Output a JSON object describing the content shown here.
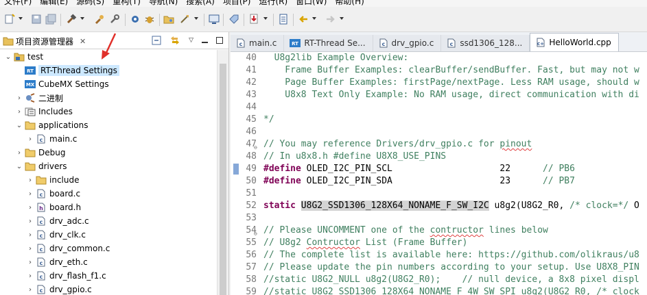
{
  "menu": [
    "文件(F)",
    "编辑(E)",
    "源码(S)",
    "重构(T)",
    "导航(N)",
    "搜索(A)",
    "项目(P)",
    "运行(R)",
    "窗口(W)",
    "帮助(H)"
  ],
  "explorer": {
    "tab_title": "项目资源管理器",
    "close_glyph": "✕",
    "tree": [
      {
        "label": "test",
        "depth": 0,
        "twisty": "⌄",
        "icon": "project-folder-icon"
      },
      {
        "label": "RT-Thread Settings",
        "depth": 1,
        "twisty": "",
        "icon": "rt-thread-icon",
        "selected": true
      },
      {
        "label": "CubeMX Settings",
        "depth": 1,
        "twisty": "",
        "icon": "cubemx-icon"
      },
      {
        "label": "二进制",
        "depth": 1,
        "twisty": "›",
        "icon": "binary-icon"
      },
      {
        "label": "Includes",
        "depth": 1,
        "twisty": "›",
        "icon": "includes-icon"
      },
      {
        "label": "applications",
        "depth": 1,
        "twisty": "⌄",
        "icon": "folder-icon"
      },
      {
        "label": "main.c",
        "depth": 2,
        "twisty": "›",
        "icon": "c-file-icon"
      },
      {
        "label": "Debug",
        "depth": 1,
        "twisty": "›",
        "icon": "folder-icon"
      },
      {
        "label": "drivers",
        "depth": 1,
        "twisty": "⌄",
        "icon": "folder-icon"
      },
      {
        "label": "include",
        "depth": 2,
        "twisty": "›",
        "icon": "folder-icon"
      },
      {
        "label": "board.c",
        "depth": 2,
        "twisty": "›",
        "icon": "c-file-icon"
      },
      {
        "label": "board.h",
        "depth": 2,
        "twisty": "›",
        "icon": "h-file-icon"
      },
      {
        "label": "drv_adc.c",
        "depth": 2,
        "twisty": "›",
        "icon": "c-file-icon"
      },
      {
        "label": "drv_clk.c",
        "depth": 2,
        "twisty": "›",
        "icon": "c-file-icon"
      },
      {
        "label": "drv_common.c",
        "depth": 2,
        "twisty": "›",
        "icon": "c-file-icon"
      },
      {
        "label": "drv_eth.c",
        "depth": 2,
        "twisty": "›",
        "icon": "c-file-icon"
      },
      {
        "label": "drv_flash_f1.c",
        "depth": 2,
        "twisty": "›",
        "icon": "c-file-icon"
      },
      {
        "label": "drv_gpio.c",
        "depth": 2,
        "twisty": "›",
        "icon": "c-file-icon"
      }
    ]
  },
  "editor": {
    "tabs": [
      {
        "label": "main.c",
        "icon": "c-file-icon"
      },
      {
        "label": "RT-Thread Se...",
        "icon": "rt-thread-icon"
      },
      {
        "label": "drv_gpio.c",
        "icon": "c-file-icon"
      },
      {
        "label": "ssd1306_128...",
        "icon": "c-file-icon"
      },
      {
        "label": "HelloWorld.cpp",
        "icon": "cpp-file-icon",
        "active": true
      }
    ],
    "lines": [
      {
        "n": "40",
        "segs": [
          {
            "t": "  U8g2lib Example Overview:",
            "c": "cm"
          }
        ]
      },
      {
        "n": "41",
        "segs": [
          {
            "t": "    Frame Buffer Examples: clearBuffer/sendBuffer. Fast, but may not w",
            "c": "cm"
          }
        ]
      },
      {
        "n": "42",
        "segs": [
          {
            "t": "    Page Buffer Examples: firstPage/nextPage. Less RAM usage, should w",
            "c": "cm"
          }
        ]
      },
      {
        "n": "43",
        "segs": [
          {
            "t": "    U8x8 Text Only Example: No RAM usage, direct communication with di",
            "c": "cm"
          }
        ]
      },
      {
        "n": "44",
        "segs": [
          {
            "t": "",
            "c": "cm"
          }
        ]
      },
      {
        "n": "45",
        "segs": [
          {
            "t": "*/",
            "c": "cm"
          }
        ]
      },
      {
        "n": "46",
        "segs": [
          {
            "t": "",
            "c": "cm"
          }
        ]
      },
      {
        "n": "47",
        "fold": true,
        "segs": [
          {
            "t": "// You may reference Drivers/drv_gpio.c for ",
            "c": "cm"
          },
          {
            "t": "pinout",
            "c": "cm squig"
          }
        ]
      },
      {
        "n": "48",
        "segs": [
          {
            "t": "// In u8x8.h #define U8X8_USE_PINS",
            "c": "cm"
          }
        ]
      },
      {
        "n": "49",
        "marker": true,
        "segs": [
          {
            "t": "#define",
            "c": "kw"
          },
          {
            "t": " OLED_I2C_PIN_SCL                    22      ",
            "c": "num"
          },
          {
            "t": "// PB6",
            "c": "cm"
          }
        ]
      },
      {
        "n": "50",
        "segs": [
          {
            "t": "#define",
            "c": "kw"
          },
          {
            "t": " OLED_I2C_PIN_SDA                    23      ",
            "c": "num"
          },
          {
            "t": "// PB7",
            "c": "cm"
          }
        ]
      },
      {
        "n": "51",
        "segs": [
          {
            "t": "",
            "c": "cm"
          }
        ]
      },
      {
        "n": "52",
        "segs": [
          {
            "t": "static",
            "c": "kw"
          },
          {
            "t": " ",
            "c": "num"
          },
          {
            "t": "U8G2_SSD1306_128X64_NONAME_F_SW_I2C",
            "c": "num hl"
          },
          {
            "t": " u8g2(U8G2_R0, ",
            "c": "num"
          },
          {
            "t": "/* clock=*/",
            "c": "cm"
          },
          {
            "t": " O",
            "c": "num"
          }
        ]
      },
      {
        "n": "53",
        "segs": [
          {
            "t": "",
            "c": "cm"
          }
        ]
      },
      {
        "n": "54",
        "fold": true,
        "segs": [
          {
            "t": "// Please UNCOMMENT one of the ",
            "c": "cm"
          },
          {
            "t": "contructor",
            "c": "cm squig"
          },
          {
            "t": " lines below",
            "c": "cm"
          }
        ]
      },
      {
        "n": "55",
        "segs": [
          {
            "t": "// U8g2 ",
            "c": "cm"
          },
          {
            "t": "Contructor",
            "c": "cm squig"
          },
          {
            "t": " List (Frame Buffer)",
            "c": "cm"
          }
        ]
      },
      {
        "n": "56",
        "segs": [
          {
            "t": "// The complete list is available here: https://github.com/olikraus/u8",
            "c": "cm"
          }
        ]
      },
      {
        "n": "57",
        "segs": [
          {
            "t": "// Please update the pin numbers according to your setup. Use U8X8_PIN",
            "c": "cm"
          }
        ]
      },
      {
        "n": "58",
        "segs": [
          {
            "t": "//static U8G2_NULL u8g2(U8G2_R0);    // null device, a 8x8 pixel displ",
            "c": "cm"
          }
        ]
      },
      {
        "n": "59",
        "segs": [
          {
            "t": "//static U8G2_SSD1306_128X64_NONAME_F_4W_SW_SPI u8g2(U8G2_R0, /* clock",
            "c": "cm"
          }
        ]
      }
    ]
  },
  "colors": {
    "selection": "#cce8ff",
    "comment": "#3f7f5f",
    "keyword": "#7f0055",
    "arrow": "#e0302a"
  }
}
